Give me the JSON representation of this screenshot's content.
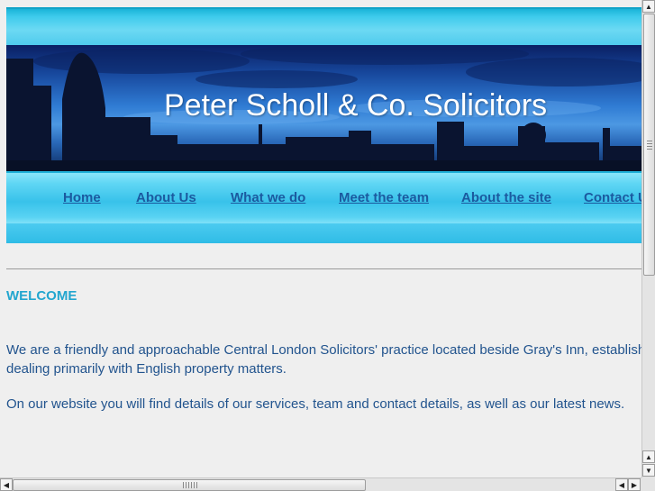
{
  "header": {
    "title": "Peter Scholl & Co. Solicitors"
  },
  "nav": {
    "items": [
      {
        "label": "Home"
      },
      {
        "label": "About Us"
      },
      {
        "label": "What we do"
      },
      {
        "label": "Meet the team"
      },
      {
        "label": "About the site"
      },
      {
        "label": "Contact Us"
      }
    ]
  },
  "content": {
    "heading": "WELCOME",
    "paragraphs": [
      "We are a friendly and approachable Central London Solicitors' practice located beside Gray's Inn, established dealing primarily with English property matters.",
      "On our website you will find details of our services, team and contact details, as well as our latest news."
    ]
  },
  "icons": {
    "scroll_up": "arrow-up-icon",
    "scroll_down": "arrow-down-icon",
    "scroll_left": "arrow-left-icon",
    "scroll_right": "arrow-right-icon"
  },
  "colors": {
    "nav_link": "#1b5aa0",
    "heading": "#22a6cf",
    "body_text": "#22548e",
    "band_cyan": "#3ecbec"
  }
}
